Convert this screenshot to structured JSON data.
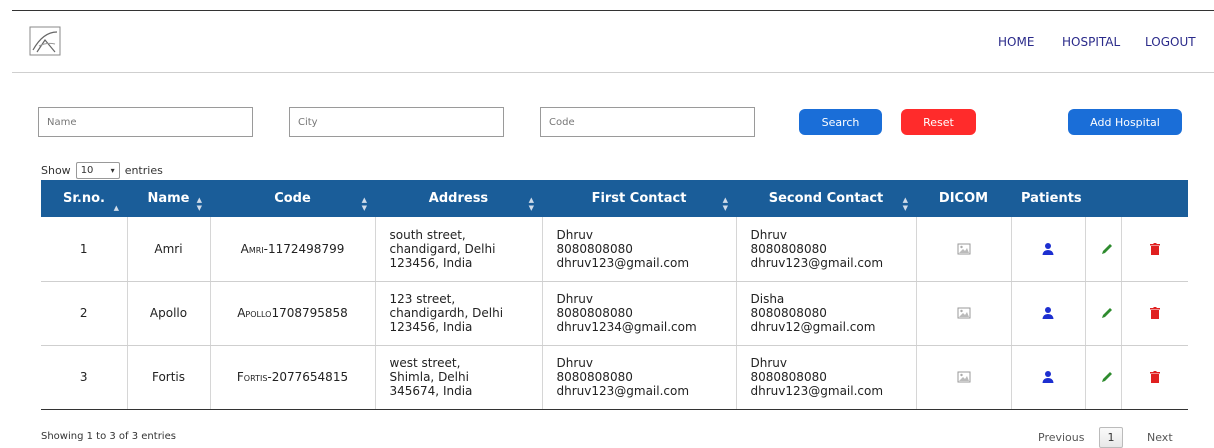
{
  "nav": {
    "home": "HOME",
    "hospital": "HOSPITAL",
    "logout": "LOGOUT"
  },
  "filters": {
    "name_placeholder": "Name",
    "city_placeholder": "City",
    "code_placeholder": "Code"
  },
  "buttons": {
    "search": "Search",
    "reset": "Reset",
    "add": "Add Hospital"
  },
  "length": {
    "show": "Show",
    "value": "10",
    "entries": "entries"
  },
  "table": {
    "headers": [
      "Sr.no.",
      "Name",
      "Code",
      "Address",
      "First Contact",
      "Second Contact",
      "DICOM",
      "Patients"
    ],
    "rows": [
      {
        "sr": "1",
        "name": "Amri",
        "code": "Amri-1172498799",
        "address": "south street,\nchandigard, Delhi\n123456, India",
        "first": "Dhruv\n8080808080\ndhruv123@gmail.com",
        "second": "Dhruv\n8080808080\ndhruv123@gmail.com"
      },
      {
        "sr": "2",
        "name": "Apollo",
        "code": "Apollo1708795858",
        "address": "123 street,\nchandigardh, Delhi\n123456, India",
        "first": "Dhruv\n8080808080\ndhruv1234@gmail.com",
        "second": "Disha\n8080808080\ndhruv12@gmail.com"
      },
      {
        "sr": "3",
        "name": "Fortis",
        "code": "Fortis-2077654815",
        "address": "west street,\nShimla, Delhi\n345674, India",
        "first": "Dhruv\n8080808080\ndhruv123@gmail.com",
        "second": "Dhruv\n8080808080\ndhruv123@gmail.com"
      }
    ]
  },
  "footer": {
    "info": "Showing 1 to 3 of 3 entries",
    "previous": "Previous",
    "page": "1",
    "next": "Next"
  },
  "colors": {
    "header_bg": "#1a5d99",
    "primary": "#1a6ed8",
    "danger": "#ff2b2b",
    "edit": "#2e8b2e",
    "user": "#1d2fd0"
  },
  "icons": [
    "logo-icon",
    "image-icon",
    "user-icon",
    "pencil-icon",
    "trash-icon",
    "sort-icon",
    "chevron-down-icon"
  ]
}
